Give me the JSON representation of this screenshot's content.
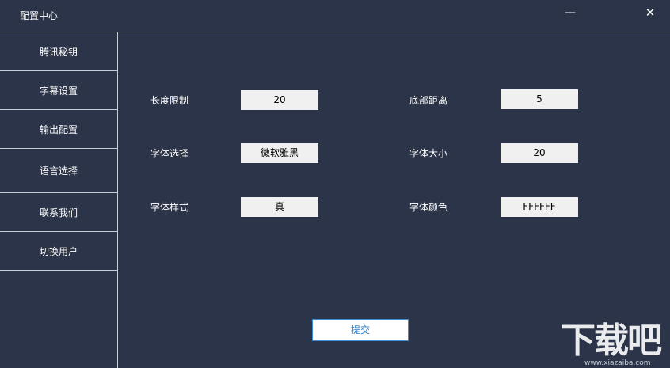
{
  "window": {
    "title": "配置中心",
    "minimize_glyph": "—",
    "close_glyph": "✕"
  },
  "sidebar": {
    "items": [
      {
        "label": "腾讯秘钥"
      },
      {
        "label": "字幕设置"
      },
      {
        "label": "输出配置"
      },
      {
        "label": "语言选择"
      },
      {
        "label": "联系我们"
      },
      {
        "label": "切换用户"
      }
    ]
  },
  "form": {
    "length_limit": {
      "label": "长度限制",
      "value": "20"
    },
    "bottom_distance": {
      "label": "底部距离",
      "value": "5"
    },
    "font_select": {
      "label": "字体选择",
      "value": "微软雅黑"
    },
    "font_size": {
      "label": "字体大小",
      "value": "20"
    },
    "font_style": {
      "label": "字体样式",
      "value": "真"
    },
    "font_color": {
      "label": "字体颜色",
      "value": "FFFFFF"
    }
  },
  "submit_label": "提交",
  "watermark": {
    "main": "下载吧",
    "sub": "www.xiazaiba.com"
  },
  "colors": {
    "background": "#2b3448",
    "divider": "#c8ccd4",
    "field_bg": "#f0f0f0",
    "button_border": "#3a8fd8",
    "button_text": "#2a7fc8"
  }
}
